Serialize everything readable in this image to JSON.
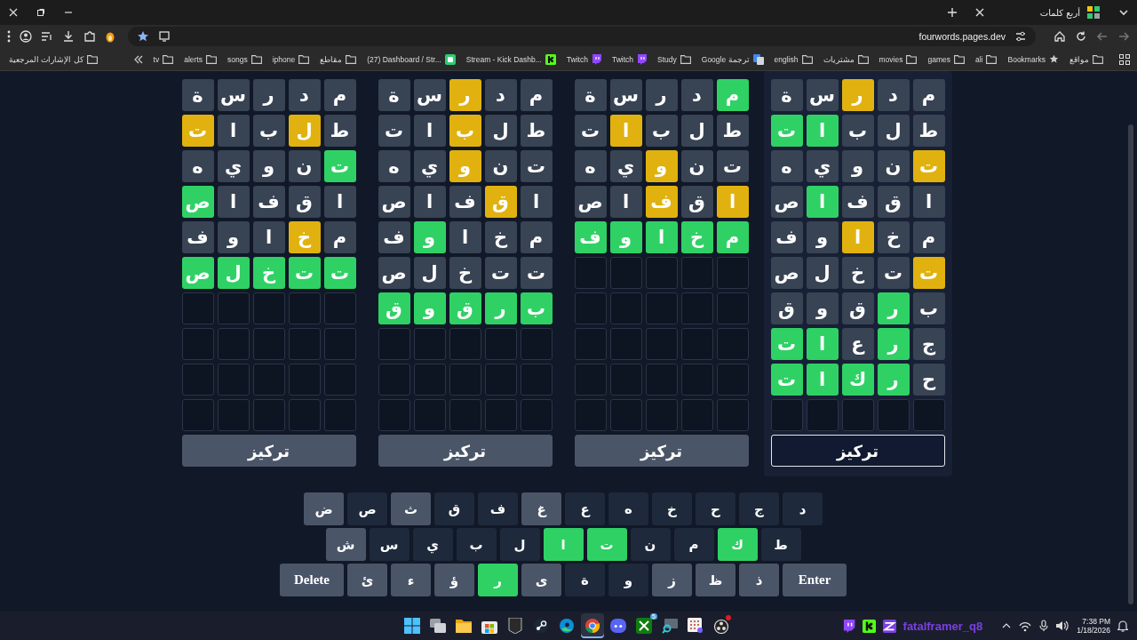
{
  "browser": {
    "tab": {
      "title": "أربع كلمات"
    },
    "url": "fourwords.pages.dev",
    "bookmarks": [
      {
        "label": "مواقع",
        "kind": "folder"
      },
      {
        "label": "Bookmarks",
        "kind": "star"
      },
      {
        "label": "ali",
        "kind": "folder"
      },
      {
        "label": "games",
        "kind": "folder"
      },
      {
        "label": "movies",
        "kind": "folder"
      },
      {
        "label": "مشتريات",
        "kind": "folder"
      },
      {
        "label": "english",
        "kind": "folder"
      },
      {
        "label": "ترجمة Google",
        "kind": "translate"
      },
      {
        "label": "Study",
        "kind": "folder"
      },
      {
        "label": "Twitch",
        "kind": "twitch"
      },
      {
        "label": "Twitch",
        "kind": "twitch"
      },
      {
        "label": "Stream - Kick Dashb...",
        "kind": "kick"
      },
      {
        "label": "(27) Dashboard / Str...",
        "kind": "dashboard"
      },
      {
        "label": "مقاطع",
        "kind": "folder"
      },
      {
        "label": "iphone",
        "kind": "folder"
      },
      {
        "label": "songs",
        "kind": "folder"
      },
      {
        "label": "alerts",
        "kind": "folder"
      },
      {
        "label": "tv",
        "kind": "folder"
      }
    ],
    "all_bookmarks": "كل الإشارات المرجعية"
  },
  "boards": [
    {
      "focus_button": {
        "label": "تركيز",
        "selected": true
      },
      "rows": [
        [
          {
            "letter": "م",
            "color": "#384354"
          },
          {
            "letter": "د",
            "color": "#384354"
          },
          {
            "letter": "ر",
            "color": "#e1b20f"
          },
          {
            "letter": "س",
            "color": "#384354"
          },
          {
            "letter": "ة",
            "color": "#384354"
          }
        ],
        [
          {
            "letter": "ط",
            "color": "#384354"
          },
          {
            "letter": "ل",
            "color": "#384354"
          },
          {
            "letter": "ب",
            "color": "#384354"
          },
          {
            "letter": "ا",
            "color": "#2fd165"
          },
          {
            "letter": "ت",
            "color": "#2fd165"
          }
        ],
        [
          {
            "letter": "ت",
            "color": "#e1b20f"
          },
          {
            "letter": "ن",
            "color": "#384354"
          },
          {
            "letter": "و",
            "color": "#384354"
          },
          {
            "letter": "ي",
            "color": "#384354"
          },
          {
            "letter": "ه",
            "color": "#384354"
          }
        ],
        [
          {
            "letter": "ا",
            "color": "#384354"
          },
          {
            "letter": "ق",
            "color": "#384354"
          },
          {
            "letter": "ف",
            "color": "#384354"
          },
          {
            "letter": "ا",
            "color": "#2fd165"
          },
          {
            "letter": "ص",
            "color": "#384354"
          }
        ],
        [
          {
            "letter": "م",
            "color": "#384354"
          },
          {
            "letter": "خ",
            "color": "#384354"
          },
          {
            "letter": "ا",
            "color": "#e1b20f"
          },
          {
            "letter": "و",
            "color": "#384354"
          },
          {
            "letter": "ف",
            "color": "#384354"
          }
        ],
        [
          {
            "letter": "ت",
            "color": "#e1b20f"
          },
          {
            "letter": "ت",
            "color": "#384354"
          },
          {
            "letter": "خ",
            "color": "#384354"
          },
          {
            "letter": "ل",
            "color": "#384354"
          },
          {
            "letter": "ص",
            "color": "#384354"
          }
        ],
        [
          {
            "letter": "ب",
            "color": "#384354"
          },
          {
            "letter": "ر",
            "color": "#2fd165"
          },
          {
            "letter": "ق",
            "color": "#384354"
          },
          {
            "letter": "و",
            "color": "#384354"
          },
          {
            "letter": "ق",
            "color": "#384354"
          }
        ],
        [
          {
            "letter": "ج",
            "color": "#384354"
          },
          {
            "letter": "ر",
            "color": "#2fd165"
          },
          {
            "letter": "ع",
            "color": "#384354"
          },
          {
            "letter": "ا",
            "color": "#2fd165"
          },
          {
            "letter": "ت",
            "color": "#2fd165"
          }
        ],
        [
          {
            "letter": "ح",
            "color": "#384354"
          },
          {
            "letter": "ر",
            "color": "#2fd165"
          },
          {
            "letter": "ك",
            "color": "#2fd165"
          },
          {
            "letter": "ا",
            "color": "#2fd165"
          },
          {
            "letter": "ت",
            "color": "#2fd165"
          }
        ]
      ]
    },
    {
      "focus_button": {
        "label": "تركيز",
        "selected": false
      },
      "rows": [
        [
          {
            "letter": "م",
            "color": "#2fd165"
          },
          {
            "letter": "د",
            "color": "#384354"
          },
          {
            "letter": "ر",
            "color": "#384354"
          },
          {
            "letter": "س",
            "color": "#384354"
          },
          {
            "letter": "ة",
            "color": "#384354"
          }
        ],
        [
          {
            "letter": "ط",
            "color": "#384354"
          },
          {
            "letter": "ل",
            "color": "#384354"
          },
          {
            "letter": "ب",
            "color": "#384354"
          },
          {
            "letter": "ا",
            "color": "#e1b20f"
          },
          {
            "letter": "ت",
            "color": "#384354"
          }
        ],
        [
          {
            "letter": "ت",
            "color": "#384354"
          },
          {
            "letter": "ن",
            "color": "#384354"
          },
          {
            "letter": "و",
            "color": "#e1b20f"
          },
          {
            "letter": "ي",
            "color": "#384354"
          },
          {
            "letter": "ه",
            "color": "#384354"
          }
        ],
        [
          {
            "letter": "ا",
            "color": "#e1b20f"
          },
          {
            "letter": "ق",
            "color": "#384354"
          },
          {
            "letter": "ف",
            "color": "#e1b20f"
          },
          {
            "letter": "ا",
            "color": "#384354"
          },
          {
            "letter": "ص",
            "color": "#384354"
          }
        ],
        [
          {
            "letter": "م",
            "color": "#2fd165"
          },
          {
            "letter": "خ",
            "color": "#2fd165"
          },
          {
            "letter": "ا",
            "color": "#2fd165"
          },
          {
            "letter": "و",
            "color": "#2fd165"
          },
          {
            "letter": "ف",
            "color": "#2fd165"
          }
        ]
      ]
    },
    {
      "focus_button": {
        "label": "تركيز",
        "selected": false
      },
      "rows": [
        [
          {
            "letter": "م",
            "color": "#384354"
          },
          {
            "letter": "د",
            "color": "#384354"
          },
          {
            "letter": "ر",
            "color": "#e1b20f"
          },
          {
            "letter": "س",
            "color": "#384354"
          },
          {
            "letter": "ة",
            "color": "#384354"
          }
        ],
        [
          {
            "letter": "ط",
            "color": "#384354"
          },
          {
            "letter": "ل",
            "color": "#384354"
          },
          {
            "letter": "ب",
            "color": "#e1b20f"
          },
          {
            "letter": "ا",
            "color": "#384354"
          },
          {
            "letter": "ت",
            "color": "#384354"
          }
        ],
        [
          {
            "letter": "ت",
            "color": "#384354"
          },
          {
            "letter": "ن",
            "color": "#384354"
          },
          {
            "letter": "و",
            "color": "#e1b20f"
          },
          {
            "letter": "ي",
            "color": "#384354"
          },
          {
            "letter": "ه",
            "color": "#384354"
          }
        ],
        [
          {
            "letter": "ا",
            "color": "#384354"
          },
          {
            "letter": "ق",
            "color": "#e1b20f"
          },
          {
            "letter": "ف",
            "color": "#384354"
          },
          {
            "letter": "ا",
            "color": "#384354"
          },
          {
            "letter": "ص",
            "color": "#384354"
          }
        ],
        [
          {
            "letter": "م",
            "color": "#384354"
          },
          {
            "letter": "خ",
            "color": "#384354"
          },
          {
            "letter": "ا",
            "color": "#384354"
          },
          {
            "letter": "و",
            "color": "#2fd165"
          },
          {
            "letter": "ف",
            "color": "#384354"
          }
        ],
        [
          {
            "letter": "ت",
            "color": "#384354"
          },
          {
            "letter": "ت",
            "color": "#384354"
          },
          {
            "letter": "خ",
            "color": "#384354"
          },
          {
            "letter": "ل",
            "color": "#384354"
          },
          {
            "letter": "ص",
            "color": "#384354"
          }
        ],
        [
          {
            "letter": "ب",
            "color": "#2fd165"
          },
          {
            "letter": "ر",
            "color": "#2fd165"
          },
          {
            "letter": "ق",
            "color": "#2fd165"
          },
          {
            "letter": "و",
            "color": "#2fd165"
          },
          {
            "letter": "ق",
            "color": "#2fd165"
          }
        ]
      ]
    },
    {
      "focus_button": {
        "label": "تركيز",
        "selected": false
      },
      "rows": [
        [
          {
            "letter": "م",
            "color": "#384354"
          },
          {
            "letter": "د",
            "color": "#384354"
          },
          {
            "letter": "ر",
            "color": "#384354"
          },
          {
            "letter": "س",
            "color": "#384354"
          },
          {
            "letter": "ة",
            "color": "#384354"
          }
        ],
        [
          {
            "letter": "ط",
            "color": "#384354"
          },
          {
            "letter": "ل",
            "color": "#e1b20f"
          },
          {
            "letter": "ب",
            "color": "#384354"
          },
          {
            "letter": "ا",
            "color": "#384354"
          },
          {
            "letter": "ت",
            "color": "#e1b20f"
          }
        ],
        [
          {
            "letter": "ت",
            "color": "#2fd165"
          },
          {
            "letter": "ن",
            "color": "#384354"
          },
          {
            "letter": "و",
            "color": "#384354"
          },
          {
            "letter": "ي",
            "color": "#384354"
          },
          {
            "letter": "ه",
            "color": "#384354"
          }
        ],
        [
          {
            "letter": "ا",
            "color": "#384354"
          },
          {
            "letter": "ق",
            "color": "#384354"
          },
          {
            "letter": "ف",
            "color": "#384354"
          },
          {
            "letter": "ا",
            "color": "#384354"
          },
          {
            "letter": "ص",
            "color": "#2fd165"
          }
        ],
        [
          {
            "letter": "م",
            "color": "#384354"
          },
          {
            "letter": "خ",
            "color": "#e1b20f"
          },
          {
            "letter": "ا",
            "color": "#384354"
          },
          {
            "letter": "و",
            "color": "#384354"
          },
          {
            "letter": "ف",
            "color": "#384354"
          }
        ],
        [
          {
            "letter": "ت",
            "color": "#2fd165"
          },
          {
            "letter": "ت",
            "color": "#2fd165"
          },
          {
            "letter": "خ",
            "color": "#2fd165"
          },
          {
            "letter": "ل",
            "color": "#2fd165"
          },
          {
            "letter": "ص",
            "color": "#2fd165"
          }
        ]
      ]
    }
  ],
  "keyboard": [
    [
      {
        "label": "د",
        "kind": "letter",
        "color": "#1e293b"
      },
      {
        "label": "ج",
        "kind": "letter",
        "color": "#1e293b"
      },
      {
        "label": "ح",
        "kind": "letter",
        "color": "#1e293b"
      },
      {
        "label": "خ",
        "kind": "letter",
        "color": "#1e293b"
      },
      {
        "label": "ه",
        "kind": "letter",
        "color": "#1e293b"
      },
      {
        "label": "ع",
        "kind": "letter",
        "color": "#1e293b"
      },
      {
        "label": "غ",
        "kind": "letter",
        "color": "#4b5568"
      },
      {
        "label": "ف",
        "kind": "letter",
        "color": "#1e293b"
      },
      {
        "label": "ق",
        "kind": "letter",
        "color": "#1e293b"
      },
      {
        "label": "ث",
        "kind": "letter",
        "color": "#4b5568"
      },
      {
        "label": "ص",
        "kind": "letter",
        "color": "#1e293b"
      },
      {
        "label": "ض",
        "kind": "letter",
        "color": "#4b5568"
      }
    ],
    [
      {
        "label": "ط",
        "kind": "letter",
        "color": "#1e293b"
      },
      {
        "label": "ك",
        "kind": "letter",
        "color": "#2fd165"
      },
      {
        "label": "م",
        "kind": "letter",
        "color": "#1e293b"
      },
      {
        "label": "ن",
        "kind": "letter",
        "color": "#1e293b"
      },
      {
        "label": "ت",
        "kind": "letter",
        "color": "#2fd165"
      },
      {
        "label": "ا",
        "kind": "letter",
        "color": "#2fd165"
      },
      {
        "label": "ل",
        "kind": "letter",
        "color": "#1e293b"
      },
      {
        "label": "ب",
        "kind": "letter",
        "color": "#1e293b"
      },
      {
        "label": "ي",
        "kind": "letter",
        "color": "#1e293b"
      },
      {
        "label": "س",
        "kind": "letter",
        "color": "#1e293b"
      },
      {
        "label": "ش",
        "kind": "letter",
        "color": "#4b5568"
      }
    ],
    [
      {
        "label": "Enter",
        "kind": "action"
      },
      {
        "label": "ذ",
        "kind": "letter",
        "color": "#4b5568"
      },
      {
        "label": "ظ",
        "kind": "letter",
        "color": "#4b5568"
      },
      {
        "label": "ز",
        "kind": "letter",
        "color": "#4b5568"
      },
      {
        "label": "و",
        "kind": "letter",
        "color": "#1e293b"
      },
      {
        "label": "ة",
        "kind": "letter",
        "color": "#1e293b"
      },
      {
        "label": "ى",
        "kind": "letter",
        "color": "#4b5568"
      },
      {
        "label": "ر",
        "kind": "letter",
        "color": "#2fd165"
      },
      {
        "label": "ؤ",
        "kind": "letter",
        "color": "#4b5568"
      },
      {
        "label": "ء",
        "kind": "letter",
        "color": "#4b5568"
      },
      {
        "label": "ئ",
        "kind": "letter",
        "color": "#4b5568"
      },
      {
        "label": "Delete",
        "kind": "action"
      }
    ]
  ],
  "taskbar": {
    "apps": [
      {
        "kind": "start",
        "active": false
      },
      {
        "kind": "taskview",
        "active": false
      },
      {
        "kind": "explorer",
        "active": false
      },
      {
        "kind": "store",
        "active": false
      },
      {
        "kind": "epic",
        "active": false
      },
      {
        "kind": "steam",
        "active": false
      },
      {
        "kind": "edge",
        "active": false
      },
      {
        "kind": "chrome",
        "active": true
      },
      {
        "kind": "discord",
        "active": false
      },
      {
        "kind": "xbox",
        "active": false,
        "badge": "5"
      },
      {
        "kind": "magnifier",
        "active": false
      },
      {
        "kind": "clip",
        "active": false
      },
      {
        "kind": "obs",
        "active": false
      }
    ],
    "overlay_text": "fatalframer_q8",
    "time": "7:38 PM",
    "date": "1/18/2026"
  }
}
